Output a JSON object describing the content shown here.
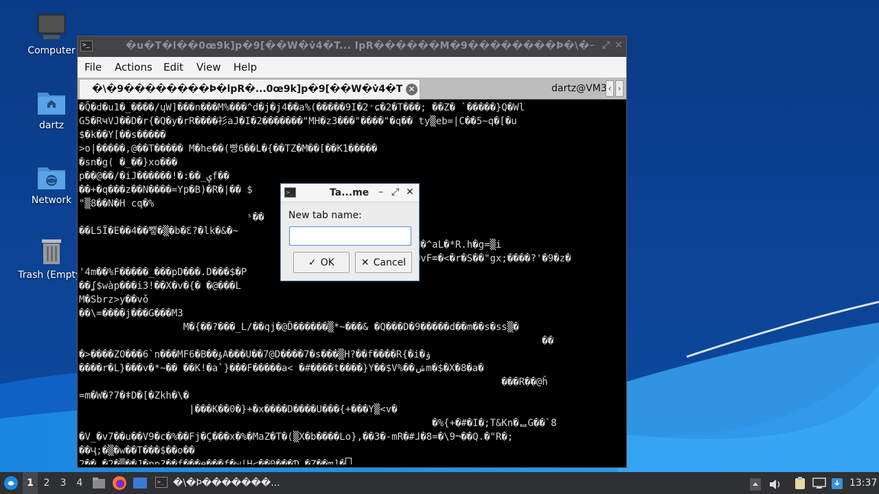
{
  "desktop": {
    "icons": [
      {
        "label": "Computer",
        "icon": "computer-icon"
      },
      {
        "label": "dartz",
        "icon": "home-folder-icon"
      },
      {
        "label": "Network",
        "icon": "network-folder-icon"
      },
      {
        "label": "Trash (Empty)",
        "icon": "trash-icon"
      }
    ]
  },
  "window": {
    "title": "�u�T�l��0œ9k]p�9[��W�v̇4�T...   lpR������M�9��������Ϸ�\\�",
    "menu": [
      "File",
      "Actions",
      "Edit",
      "View",
      "Help"
    ],
    "tabs": {
      "active": "�\\�9��������Ϸ�lpR�...0œ9k]p�9[��W�v̇4�T",
      "second": "dartz@VM3",
      "close_glyph": "✕",
      "left_arrow": "‹",
      "right_arrow": "›"
    },
    "terminal_lines": [
      "�Q̄�d�u1�_����/ɥW]���n���M%���^d�j�j4��a%(�����9I�2̛ɕ�2�T���; ��Z� `�����}Q�Wl",
      "G5�RҸVJ��D�r{�Q�y�rR����衫aJ�I�2�������\"MH�z3���\"����\"�q�� ty▒eb=|C��5~q�[�u",
      "$�k��Y[��s�����",
      ">o|�����,@��T����� M�he��(빵6��L�{��TZ�M��[��K1�����",
      "�sn�g( �_��}xo���",
      "p��@��/�iJ������!�:��_ؠf��",
      "��+�q���z��N����=Yp�B)�R�|�� $",
      "\"▒8��N�H cq�%",
      "                             ˢ��",
      "��L5Ï�E��4��뾓�▒�b�Ɛ?�lk�&�~",
      "                                                          N�^aL�*R.h�g=▒i",
      "                                                          �vF⌧�<�r�S��\"gx;����?'�9�z�",
      "'4m��%F�����_���pD���.D���$�P",
      "��ʆ$wàp���i3!��X�v�{� �@���L",
      "M�Sbrz>y��vǒ",
      "��\\=����j���G���M3",
      "                  M�{��?���_L/��qj�@Ď������▒*~���& �Q���D�9�����d��m��s�ss▒�",
      "                                                                                ��",
      "�>����ZO���6`n���MF6�B��ۇA���U��7@D����7�s���▒H?��f����R{�i�ۏ",
      "����r�L}���v�*~�� ��K!�a`}���F�����a< �#����t����}Y��$V%��ݽm�$�X�8�a�",
      "                                                                         ���R��@ȟ",
      "=m�W�?7�ǂD�[�Zkh�\\�",
      "                   |���K��0�}+�x����D����U���{+���Y▒<v�",
      "                                                             �%{+�#�I�;T&Kn�ᆸG��`8",
      "�V_�v7��u��V9�c�%��Fj�Ç���x�%�MaZ�T�(▒X�b����Lo},��3�-mR�#ɺ�8=�\\9¬��Q.�\"R�;",
      "��Ҷ;�▒�w��T���$��o��",
      "2��.�2�▒��J�pp?��f���e���f�w|H<��0���Ɗ_�Z��m]�"
    ]
  },
  "dialog": {
    "title": "Ta...me",
    "label": "New tab name:",
    "input_value": "",
    "ok_label": "OK",
    "cancel_label": "Cancel",
    "minimize_glyph": "–",
    "maximize_glyph": "⤢",
    "close_glyph": "✕",
    "ok_glyph": "✓",
    "cancel_glyph": "✕"
  },
  "taskbar": {
    "workspaces": [
      "1",
      "2",
      "3",
      "4"
    ],
    "active_workspace": "1",
    "task_label": "�\\�Ϸ�������...",
    "clock": "13:37"
  },
  "colors": {
    "accent": "#4c87d8",
    "terminal_bg": "#000000",
    "terminal_fg": "#d8d8d8",
    "taskbar_bg": "#2f3033"
  }
}
